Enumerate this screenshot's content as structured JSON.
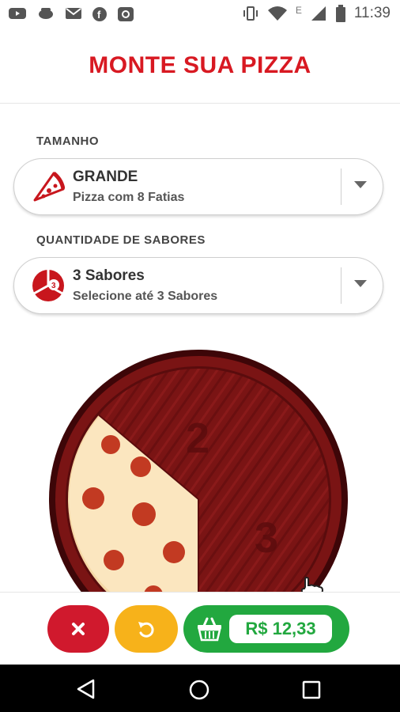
{
  "status_bar": {
    "time": "11:39",
    "network_label": "E",
    "icons": [
      "youtube-icon",
      "bug-icon",
      "gmail-icon",
      "facebook-icon",
      "app-icon",
      "vibrate-icon",
      "wifi-icon",
      "signal-icon",
      "battery-icon"
    ]
  },
  "header": {
    "title": "MONTE SUA PIZZA"
  },
  "size_section": {
    "label": "TAMANHO",
    "selected": "GRANDE",
    "description": "Pizza com 8 Fatias"
  },
  "flavors_section": {
    "label": "QUANTIDADE DE SABORES",
    "selected": "3 Sabores",
    "description": "Selecione até 3 Sabores",
    "icon_badge": "3"
  },
  "pizza_slots": [
    "2",
    "3"
  ],
  "actions": {
    "cancel_icon": "close-icon",
    "reset_icon": "undo-icon",
    "cart_icon": "basket-icon",
    "price": "R$ 12,33"
  },
  "nav": {
    "icons": [
      "back-icon",
      "home-icon",
      "recents-icon"
    ]
  },
  "colors": {
    "brand_red": "#d81922",
    "cancel": "#d0192d",
    "reset": "#f7b21a",
    "cart": "#22a83f",
    "wood": "#7a1414"
  }
}
